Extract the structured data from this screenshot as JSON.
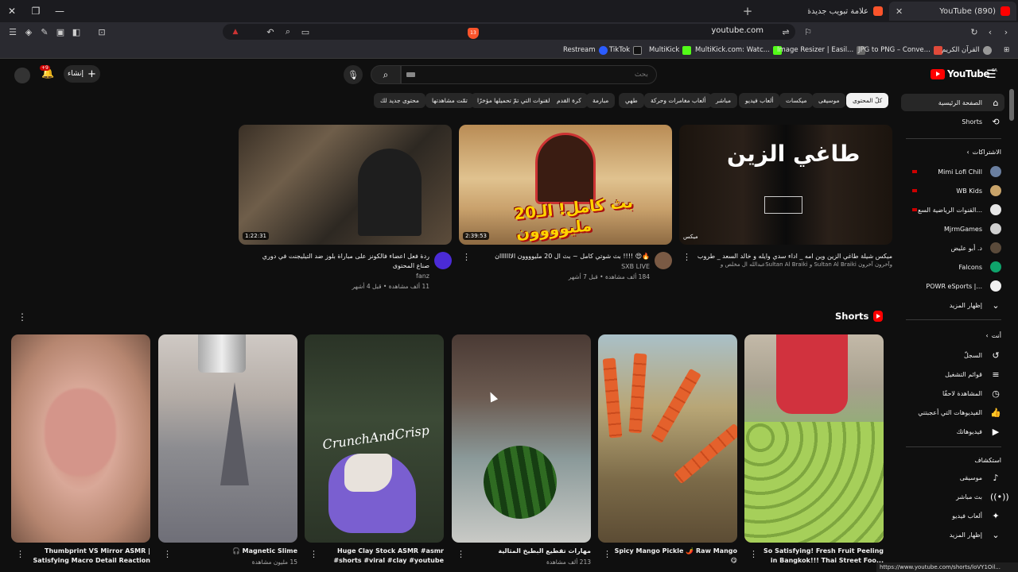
{
  "browser": {
    "tabs": [
      {
        "label": "علامة تبويب جديدة",
        "favicon": "brave-icon"
      },
      {
        "label": "(890) YouTube",
        "favicon": "youtube-icon"
      }
    ],
    "url": "youtube.com",
    "bookmarks": [
      {
        "label": "Restream",
        "color": "#2b5cff"
      },
      {
        "label": "TikTok",
        "color": "#111111"
      },
      {
        "label": "MultiKick",
        "color": "#53fc18"
      },
      {
        "label": "MultiKick.com: Watc...",
        "color": "#53fc18"
      },
      {
        "label": "Image Resizer | Easil...",
        "color": "#666666"
      },
      {
        "label": "JPG to PNG – Conve...",
        "color": "#e04a3a"
      },
      {
        "label": "القرآن الكريم",
        "color": "#999999"
      }
    ],
    "shield_badge": "13",
    "status_url": "https://www.youtube.com/shorts/loVY1Oil..."
  },
  "header": {
    "create_label": "إنشاء",
    "bell_badge": "+9",
    "search_placeholder": "بحث",
    "logo_text": "YouTube",
    "logo_country": "SA"
  },
  "chips": [
    {
      "label": "كلّ المحتوى",
      "active": true
    },
    {
      "label": "موسيقى"
    },
    {
      "label": "ميكسات"
    },
    {
      "label": "ألعاب فيديو"
    },
    {
      "label": "مباشر"
    },
    {
      "label": "ألعاب مغامرات وحركة"
    },
    {
      "label": "طهي"
    },
    {
      "label": "مبارمة"
    },
    {
      "label": "كرة القدم"
    },
    {
      "label": "القنوات التي تمّ تحميلها مؤخرًا"
    },
    {
      "label": "تمّت مشاهدتها"
    },
    {
      "label": "محتوى جديد لك"
    }
  ],
  "sidebar": {
    "main": [
      {
        "label": "الصفحة الرئيسية",
        "icon": "home-icon"
      },
      {
        "label": "Shorts",
        "icon": "shorts-icon"
      }
    ],
    "subs_heading": "الاشتراكات",
    "subs": [
      {
        "label": "Mimi Lofi Chill",
        "live": true
      },
      {
        "label": "WB Kids",
        "live": true
      },
      {
        "label": "القنوات الرياضية السع...",
        "live": true
      },
      {
        "label": "MjrmGames"
      },
      {
        "label": "د. أبو عليض"
      },
      {
        "label": "Falcons"
      },
      {
        "label": "POWR eSports |...",
        "dot": true
      }
    ],
    "show_more": "إظهار المزيد",
    "you_heading": "أنت",
    "you": [
      {
        "label": "السجلّ",
        "icon": "history-icon"
      },
      {
        "label": "قوائم التشغيل",
        "icon": "playlist-icon"
      },
      {
        "label": "المشاهدة لاحقًا",
        "icon": "clock-icon"
      },
      {
        "label": "الفيديوهات التي أعجبتني",
        "icon": "thumbs-up-icon"
      },
      {
        "label": "فيديوهاتك",
        "icon": "your-videos-icon"
      }
    ],
    "explore_heading": "استكشاف",
    "explore": [
      {
        "label": "موسيقى",
        "icon": "music-icon"
      },
      {
        "label": "بث مباشر",
        "icon": "live-icon"
      },
      {
        "label": "ألعاب فيديو",
        "icon": "gaming-icon"
      },
      {
        "label": "إظهار المزيد",
        "icon": "chevron-down-icon"
      }
    ]
  },
  "videos": [
    {
      "duration": "1:22:31",
      "title": "ردة فعل اعضاء فالكونز على مباراة بلوز ضد التيليجنت في دوري صناع المحتوى",
      "channel": "fanz",
      "stats": "11 ألف مشاهدة • قبل 4 أشهر",
      "avatar_color": "#4b2bd6"
    },
    {
      "duration": "2:39:53",
      "title": "بث شوتي كامل ~ بث ال 20 مليوووون الااااااان !!!! 😍🔥",
      "channel": "SXB LIVE",
      "stats": "184 ألف مشاهدة • قبل 7 أشهر",
      "avatar_color": "#7a5a44",
      "art_text": "بث كامل! الـ20 مليوووون"
    },
    {
      "duration": "ميكس",
      "title": "ميكس شيلة طاغي الزين وين امه _ اداء سدي وايله و خالد السعد _ طروب",
      "channel": "عبدالله ال مخلص وSultan Al Braiki و Sultan Al Braiki وآخرون آخرون",
      "stats": "",
      "avatar_color": "#333333",
      "art_text": "طاغي الزين"
    }
  ],
  "shorts": {
    "heading": "Shorts",
    "items": [
      {
        "title": "Thumbprint VS Mirror ASMR | Satisfying Macro Detail Reaction",
        "views": ""
      },
      {
        "title": "🎧 Magnetic Slime",
        "views": "15 مليون مشاهدة"
      },
      {
        "title": "Huge Clay Stock ASMR #asmr #shorts #viral #clay #youtube",
        "views": "",
        "art_text": "CrunchAndCrisp"
      },
      {
        "title": "مهارات تقطيع البطيخ المثالية",
        "views": "213 ألف مشاهدة"
      },
      {
        "title": "Spicy Mango Pickle 🌶️ Raw Mango 😋",
        "views": ""
      },
      {
        "title": "So Satisfying! Fresh Fruit Peeling in Bangkok!!! Thai Street Foo...",
        "views": ""
      }
    ]
  }
}
